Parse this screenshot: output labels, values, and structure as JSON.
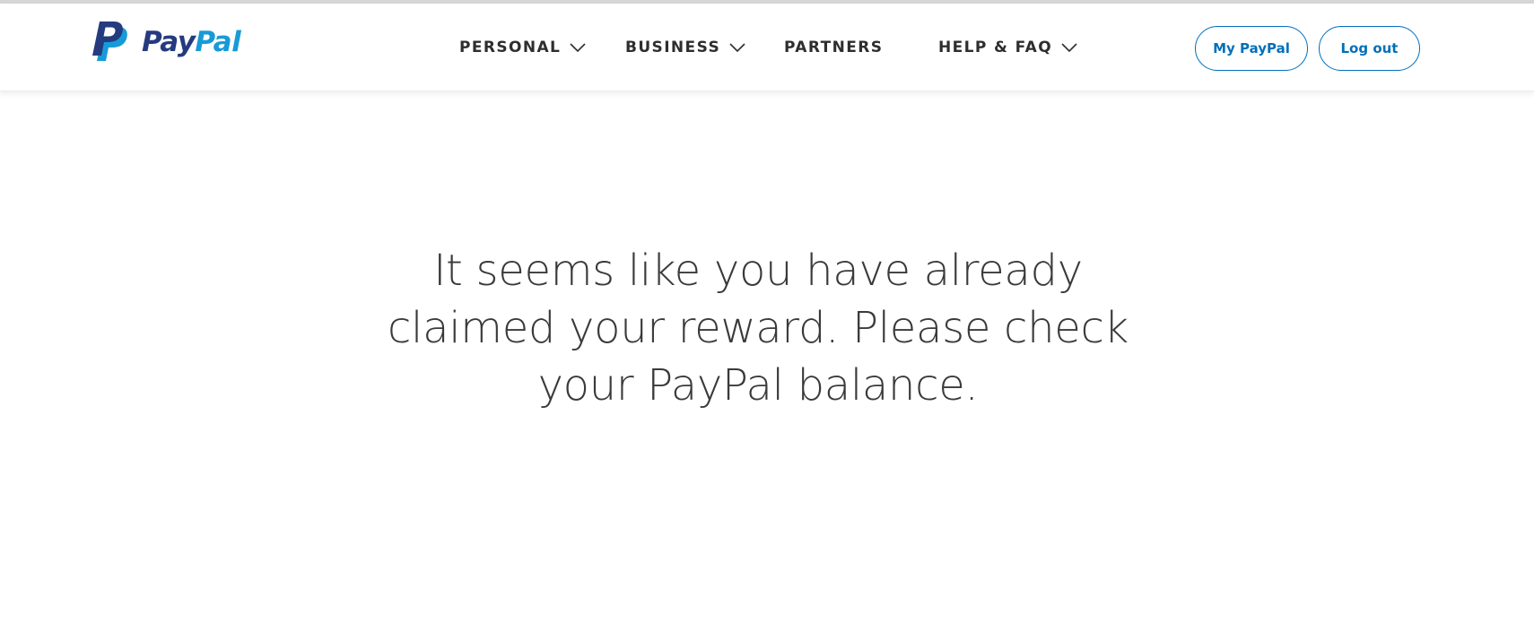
{
  "brand": {
    "name_part1": "Pay",
    "name_part2": "Pal",
    "colors": {
      "dark": "#253b80",
      "light": "#179bd7"
    }
  },
  "nav": {
    "items": [
      {
        "label": "PERSONAL",
        "has_dropdown": true
      },
      {
        "label": "BUSINESS",
        "has_dropdown": true
      },
      {
        "label": "PARTNERS",
        "has_dropdown": false
      },
      {
        "label": "HELP & FAQ",
        "has_dropdown": true
      }
    ]
  },
  "header_actions": {
    "my_paypal_label": "My PayPal",
    "logout_label": "Log out",
    "accent_color": "#0070ba"
  },
  "main": {
    "message": "It seems like you have already claimed your reward. Please check your PayPal balance."
  }
}
